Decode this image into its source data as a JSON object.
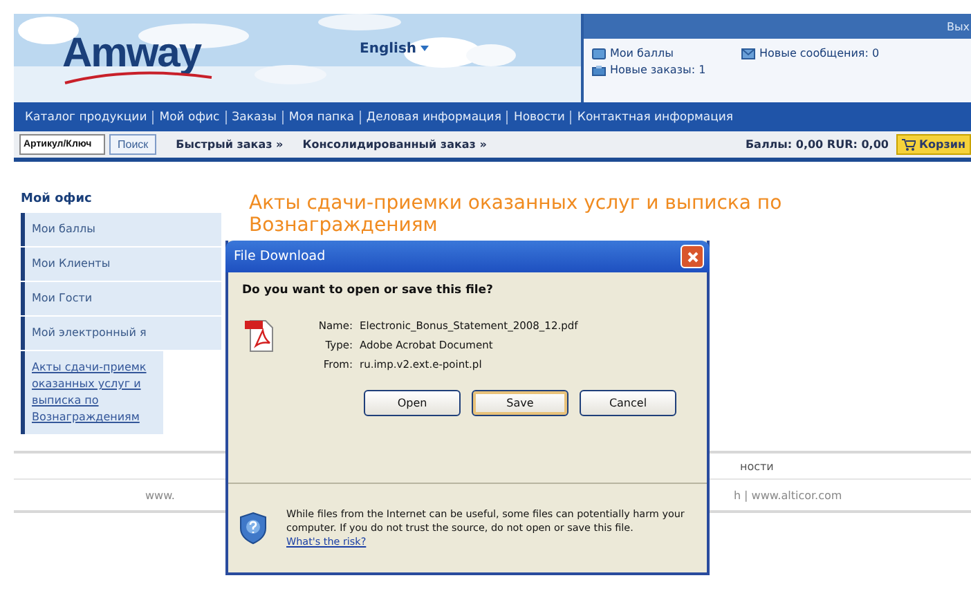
{
  "header": {
    "logo": "Amway",
    "language": "English",
    "logout": "Вых",
    "links": [
      {
        "label": "Мои баллы",
        "kind": "card"
      },
      {
        "label": "Новые сообщения: 0",
        "kind": "mail"
      },
      {
        "label": "Новые заказы: 1",
        "kind": "box"
      }
    ]
  },
  "nav": [
    "Каталог продукции",
    "Мой офис",
    "Заказы",
    "Моя папка",
    "Деловая информация",
    "Новости",
    "Контактная информация"
  ],
  "subbar": {
    "search": {
      "placeholder": "Артикул/Ключ"
    },
    "search_button": "Поиск",
    "links": [
      "Быстрый заказ »",
      "Консолидированный заказ »"
    ],
    "balance": "Баллы: 0,00  RUR: 0,00",
    "cart": "Корзин"
  },
  "sidebar": {
    "title": "Мой офис",
    "items": [
      {
        "label": "Мои баллы",
        "selected": false
      },
      {
        "label": "Мои Клиенты",
        "selected": false
      },
      {
        "label": "Мои Гости",
        "selected": false
      },
      {
        "label": "Мой электронный я",
        "selected": false
      },
      {
        "label": "Акты сдачи-приемк оказанных услуг и выписка по Вознаграждениям",
        "selected": true
      }
    ]
  },
  "page_title": "Акты сдачи-приемки оказанных услуг и выписка по Вознаграждениям",
  "footer": {
    "line_1": "ности",
    "left": "www.",
    "right": "h | www.alticor.com"
  },
  "dialog": {
    "title": "File Download",
    "question": "Do you want to open or save this file?",
    "fields": [
      {
        "label": "Name:",
        "value": "Electronic_Bonus_Statement_2008_12.pdf"
      },
      {
        "label": "Type:",
        "value": "Adobe Acrobat Document"
      },
      {
        "label": "From:",
        "value": "ru.imp.v2.ext.e-point.pl"
      }
    ],
    "buttons": [
      {
        "label": "Open",
        "selected": false
      },
      {
        "label": "Save",
        "selected": true
      },
      {
        "label": "Cancel",
        "selected": false
      }
    ],
    "warning": "While files from the Internet can be useful, some files can potentially harm your computer. If you do not trust the source, do not open or save this file.",
    "risk_link": "What's the risk?"
  }
}
